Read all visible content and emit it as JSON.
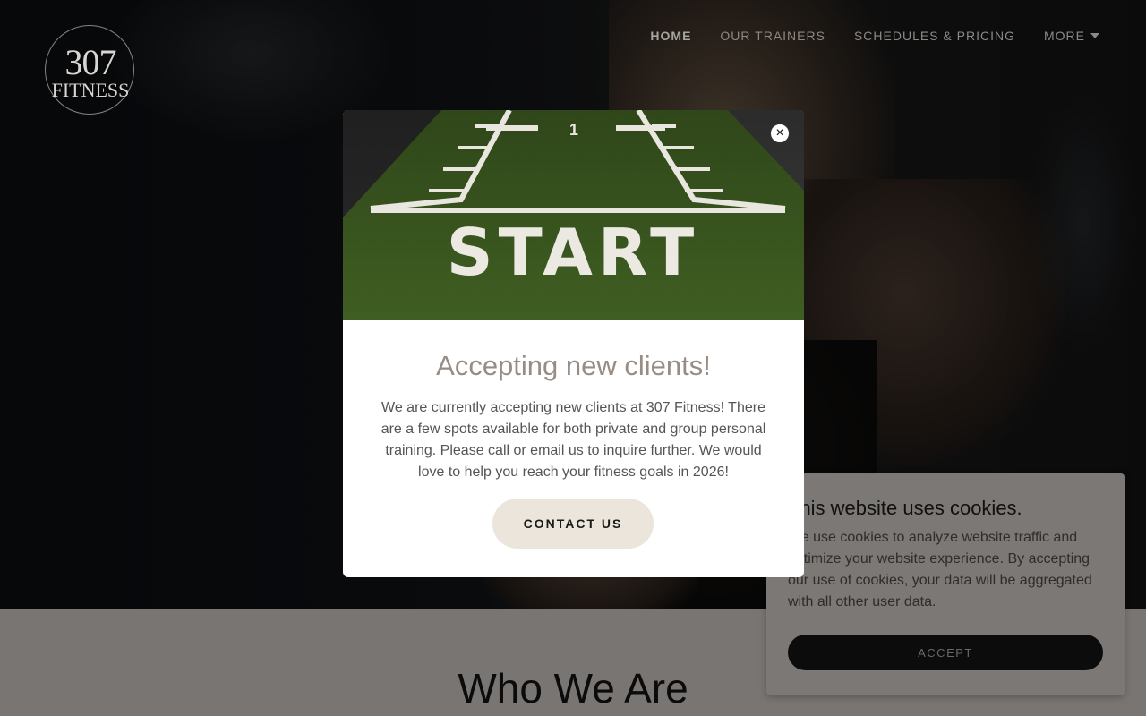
{
  "logo": {
    "number": "307",
    "word": "FITNESS"
  },
  "nav": {
    "items": [
      {
        "label": "HOME"
      },
      {
        "label": "OUR TRAINERS"
      },
      {
        "label": "SCHEDULES & PRICING"
      },
      {
        "label": "MORE"
      }
    ],
    "active": "HOME"
  },
  "section": {
    "heading": "Who We Are"
  },
  "modal": {
    "image_text": "START",
    "image_number": "1",
    "close_symbol": "×",
    "title": "Accepting new clients!",
    "body": "We are currently accepting new clients at 307 Fitness! There are a few spots available for both private and group personal training. Please call or email us to inquire further. We would love to help you reach your fitness goals in 2026!",
    "cta_label": "CONTACT US"
  },
  "cookie": {
    "title": "This website uses cookies.",
    "text": "We use cookies to analyze website traffic and optimize your website experience. By accepting our use of cookies, your data will be aggregated with all other user data.",
    "accept_label": "ACCEPT"
  },
  "colors": {
    "modal_title": "#978d84",
    "cta_bg": "#ece5dc",
    "accept_bg": "#0c0c0c",
    "turf": "#3f5e22"
  }
}
